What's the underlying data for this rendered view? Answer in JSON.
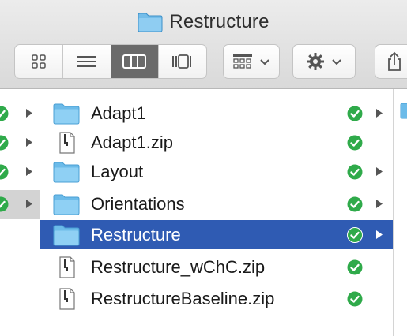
{
  "window": {
    "title": "Restructure"
  },
  "toolbar": {
    "view_buttons": [
      {
        "name": "icon-view",
        "active": false
      },
      {
        "name": "list-view",
        "active": false
      },
      {
        "name": "column-view",
        "active": true
      },
      {
        "name": "cover-flow-view",
        "active": false
      }
    ]
  },
  "files": [
    {
      "name": "Adapt1",
      "type": "folder",
      "synced": true,
      "has_children": true
    },
    {
      "name": "Adapt1.zip",
      "type": "zip",
      "synced": true,
      "has_children": false
    },
    {
      "name": "Layout",
      "type": "folder",
      "synced": true,
      "has_children": true
    },
    {
      "name": "Orientations",
      "type": "folder",
      "synced": true,
      "has_children": true
    },
    {
      "name": "Restructure",
      "type": "folder",
      "synced": true,
      "has_children": true,
      "selected": true
    },
    {
      "name": "Restructure_wChC.zip",
      "type": "zip",
      "synced": true,
      "has_children": false
    },
    {
      "name": "RestructureBaseline.zip",
      "type": "zip",
      "synced": true,
      "has_children": false
    }
  ],
  "colors": {
    "selection": "#2f5bb3",
    "folder": "#5fb3e6",
    "sync_ok": "#2faa4a"
  }
}
